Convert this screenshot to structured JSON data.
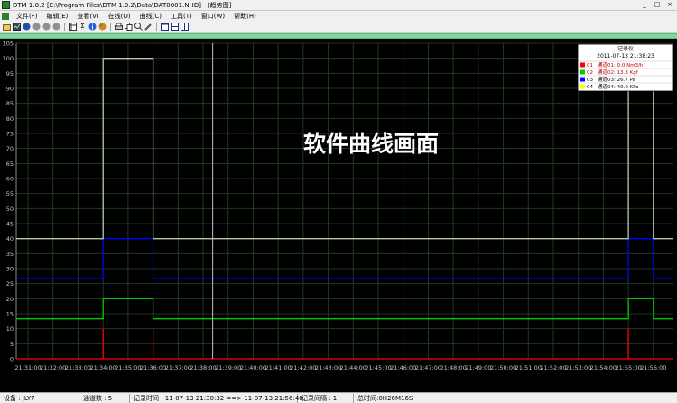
{
  "window": {
    "title": "DTM 1.0.2 [E:\\Program Files\\DTM 1.0.2\\Data\\DAT0001.NHD] - [趋势图]",
    "min": "_",
    "max": "□",
    "close": "×"
  },
  "menu": [
    "文件(F)",
    "编辑(E)",
    "查看(V)",
    "在线(O)",
    "曲线(C)",
    "工具(T)",
    "窗口(W)",
    "帮助(H)"
  ],
  "toolbar": {
    "icons": [
      "open-icon",
      "save-icon",
      "record-icon",
      "circle-icon",
      "circle-icon",
      "circle-icon",
      "table-icon",
      "sum-icon",
      "info-icon",
      "color-icon",
      "print-icon",
      "copy-icon",
      "zoom-icon",
      "tool-icon",
      "window1-icon",
      "window2-icon",
      "window3-icon"
    ]
  },
  "overlay_text": "软件曲线画面",
  "legend": {
    "title": "记录仪",
    "datetime": "2011-07-13 21:38:23",
    "entries": [
      {
        "id": "01",
        "label": "通道01: 0.0 Nm3/h",
        "color": "#ff0000",
        "text_color": "#c00000"
      },
      {
        "id": "02",
        "label": "通道02: 13.3 Kgf",
        "color": "#00cc00",
        "text_color": "#c00000"
      },
      {
        "id": "03",
        "label": "通道03: 26.7 Pa",
        "color": "#0000ff",
        "text_color": "#000000"
      },
      {
        "id": "04",
        "label": "通道04: 40.0 KPa",
        "color": "#ffff00",
        "text_color": "#000000"
      }
    ]
  },
  "status": {
    "device": "设备 : JLY7",
    "channels": "通道数 : 5",
    "record_time": "记录时间 : 11-07-13 21:30:32 ==> 11-07-13 21:56:48",
    "interval": "记录间隔 : 1",
    "total": "总时间:0H26M16S"
  },
  "chart_data": {
    "type": "line",
    "ylim": [
      0,
      105
    ],
    "yticks": [
      0,
      5,
      10,
      15,
      20,
      25,
      30,
      35,
      40,
      45,
      50,
      55,
      60,
      65,
      70,
      75,
      80,
      85,
      90,
      95,
      100,
      105
    ],
    "categories": [
      "21:31:00",
      "21:32:00",
      "21:33:00",
      "21:34:00",
      "21:35:00",
      "21:36:00",
      "21:37:00",
      "21:38:00",
      "21:39:00",
      "21:40:00",
      "21:41:00",
      "21:42:00",
      "21:43:00",
      "21:44:00",
      "21:45:00",
      "21:46:00",
      "21:47:00",
      "21:48:00",
      "21:49:00",
      "21:50:00",
      "21:51:00",
      "21:52:00",
      "21:53:00",
      "21:54:00",
      "21:55:00",
      "21:56:00"
    ],
    "x_min_minutes": 30.53,
    "x_max_minutes": 56.8,
    "cursor_time": "21:38:23",
    "series": [
      {
        "name": "通道01",
        "color": "#ff0000",
        "points": [
          [
            "21:30:32",
            0
          ],
          [
            "21:34:00",
            0
          ],
          [
            "21:34:00",
            10
          ],
          [
            "21:34:00",
            0
          ],
          [
            "21:36:00",
            0
          ],
          [
            "21:36:00",
            10
          ],
          [
            "21:36:00",
            0
          ],
          [
            "21:55:00",
            0
          ],
          [
            "21:55:00",
            10
          ],
          [
            "21:55:00",
            0
          ],
          [
            "21:56:48",
            0
          ]
        ]
      },
      {
        "name": "通道02",
        "color": "#00cc00",
        "points": [
          [
            "21:30:32",
            13.3
          ],
          [
            "21:34:00",
            13.3
          ],
          [
            "21:34:00",
            20
          ],
          [
            "21:36:00",
            20
          ],
          [
            "21:36:00",
            13.3
          ],
          [
            "21:55:00",
            13.3
          ],
          [
            "21:55:00",
            20
          ],
          [
            "21:56:00",
            20
          ],
          [
            "21:56:00",
            13.3
          ],
          [
            "21:56:48",
            13.3
          ]
        ]
      },
      {
        "name": "通道03",
        "color": "#0000ff",
        "points": [
          [
            "21:30:32",
            26.7
          ],
          [
            "21:34:00",
            26.7
          ],
          [
            "21:34:00",
            40
          ],
          [
            "21:36:00",
            40
          ],
          [
            "21:36:00",
            26.7
          ],
          [
            "21:55:00",
            26.7
          ],
          [
            "21:55:00",
            40
          ],
          [
            "21:56:00",
            40
          ],
          [
            "21:56:00",
            26.7
          ],
          [
            "21:56:48",
            26.7
          ]
        ]
      },
      {
        "name": "通道04",
        "color": "#b8c8a8",
        "points": [
          [
            "21:30:32",
            40
          ],
          [
            "21:34:00",
            40
          ],
          [
            "21:34:00",
            100
          ],
          [
            "21:36:00",
            100
          ],
          [
            "21:36:00",
            40
          ],
          [
            "21:55:00",
            40
          ],
          [
            "21:55:00",
            100
          ],
          [
            "21:56:00",
            100
          ],
          [
            "21:56:00",
            40
          ],
          [
            "21:56:48",
            40
          ]
        ]
      }
    ]
  }
}
